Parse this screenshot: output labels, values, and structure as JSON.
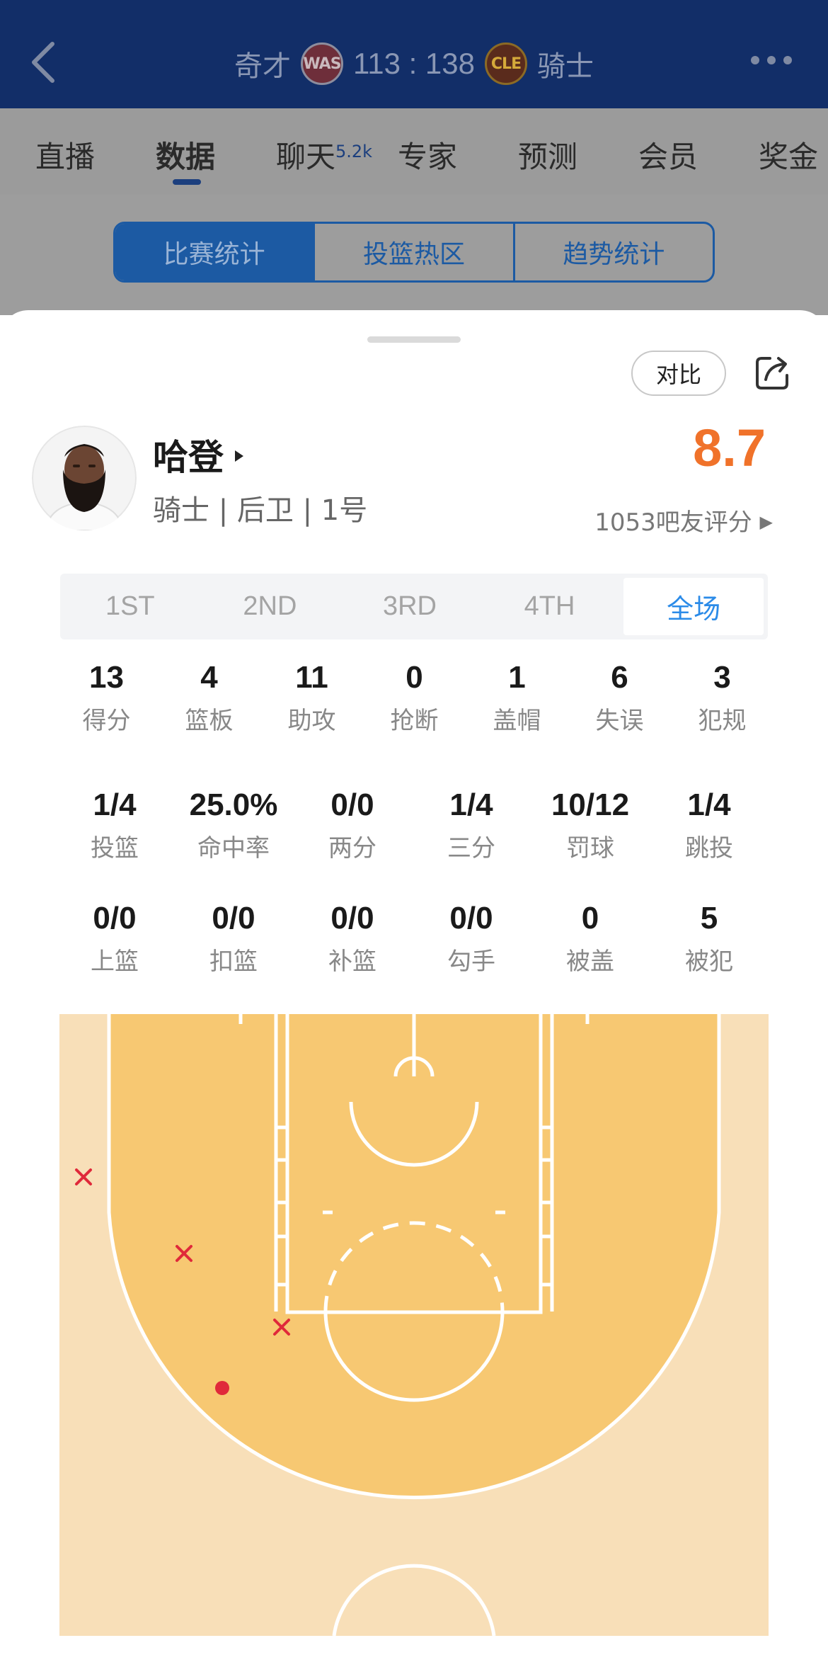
{
  "header": {
    "away_team": "奇才",
    "away_logo": "WAS",
    "score": "113 : 138",
    "home_logo": "CLE",
    "home_team": "骑士"
  },
  "nav": {
    "tabs": [
      "直播",
      "数据",
      "聊天",
      "专家",
      "预测",
      "会员",
      "奖金"
    ],
    "chat_count": "5.2k",
    "active": "数据"
  },
  "segment": {
    "items": [
      "比赛统计",
      "投篮热区",
      "趋势统计"
    ],
    "active": "比赛统计"
  },
  "sheet": {
    "compare_label": "对比",
    "player": {
      "name": "哈登",
      "info": "骑士 | 后卫 | 1号",
      "rating": "8.7",
      "rating_count": "1053吧友评分"
    },
    "quarters": [
      "1ST",
      "2ND",
      "3RD",
      "4TH",
      "全场"
    ],
    "active_quarter": "全场",
    "stats_row1": [
      {
        "value": "13",
        "label": "得分"
      },
      {
        "value": "4",
        "label": "篮板"
      },
      {
        "value": "11",
        "label": "助攻"
      },
      {
        "value": "0",
        "label": "抢断"
      },
      {
        "value": "1",
        "label": "盖帽"
      },
      {
        "value": "6",
        "label": "失误"
      },
      {
        "value": "3",
        "label": "犯规"
      }
    ],
    "stats_row2": [
      {
        "value": "1/4",
        "label": "投篮"
      },
      {
        "value": "25.0%",
        "label": "命中率"
      },
      {
        "value": "0/0",
        "label": "两分"
      },
      {
        "value": "1/4",
        "label": "三分"
      },
      {
        "value": "10/12",
        "label": "罚球"
      },
      {
        "value": "1/4",
        "label": "跳投"
      }
    ],
    "stats_row3": [
      {
        "value": "0/0",
        "label": "上篮"
      },
      {
        "value": "0/0",
        "label": "扣篮"
      },
      {
        "value": "0/0",
        "label": "补篮"
      },
      {
        "value": "0/0",
        "label": "勾手"
      },
      {
        "value": "0",
        "label": "被盖"
      },
      {
        "value": "5",
        "label": "被犯"
      }
    ],
    "shot_chart": {
      "shots": [
        {
          "result": "miss"
        },
        {
          "result": "miss"
        },
        {
          "result": "miss"
        },
        {
          "result": "make"
        }
      ],
      "colors": {
        "miss": "#e0293a",
        "make": "#e0293a",
        "paint": "#f7c872",
        "floor": "#f8dfb8"
      }
    }
  }
}
